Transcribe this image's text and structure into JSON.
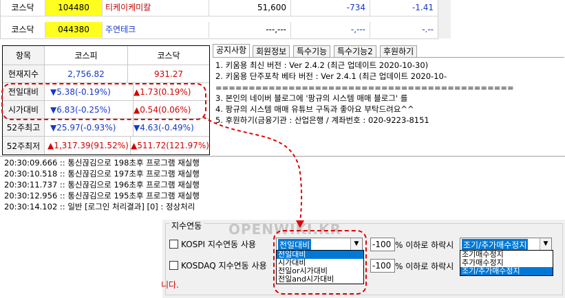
{
  "stock_table": {
    "rows": [
      {
        "market": "코스닥",
        "code": "104480",
        "name": "티케이케미칼",
        "price": "51,600",
        "change": "-734",
        "pct": "-1.41"
      },
      {
        "market": "코스닥",
        "code": "044380",
        "name": "주연테크",
        "price": "---,---",
        "change": "-,---",
        "pct": "-.--"
      }
    ]
  },
  "index_table": {
    "headers": [
      "항목",
      "코스피",
      "코스닥"
    ],
    "rows": [
      {
        "label": "현재지수",
        "kospi": "2,756.82",
        "kosdaq": "931.27"
      },
      {
        "label": "전일대비",
        "kospi": "▼5.38(-0.19%)",
        "kosdaq": "▲1.73(0.19%)"
      },
      {
        "label": "시가대비",
        "kospi": "▼6.83(-0.25%)",
        "kosdaq": "▲0.54(0.06%)"
      },
      {
        "label": "52주최고",
        "kospi": "▼25.97(-0.93%)",
        "kosdaq": "▼4.63(-0.49%)"
      },
      {
        "label": "52주최저",
        "kospi": "▲1,317.39(91.52%)",
        "kosdaq": "▲511.72(121.97%)"
      }
    ]
  },
  "notice_panel": {
    "tabs": [
      "공지사항",
      "회원정보",
      "특수기능",
      "특수기능2",
      "후원하기"
    ],
    "lines": [
      "1. 키움용 최신 버전 : Ver 2.4.2 (최근 업데이트 2020-10-30)",
      "2. 키움용 단주포착 베타 버전 : Ver 2.4.1 (최근 업데이트 2020-10-",
      "=============================================",
      "3. 본인의 네이버 블로그에 '팡규의 시스템 매매 블로그' 를",
      "4. 팡규의 시스템 매매 유튜브 구독과 좋아요 부탁드려요^^",
      "5. 후원하기(금융기관 : 산업은행 / 계좌번호 : 020-9223-8151"
    ]
  },
  "log_panel": {
    "lines": [
      "20:30:09.666 :: 통신끊김으로 198초후 프로그램 재실행",
      "20:30:10.518 :: 통신끊김으로 197초후 프로그램 재실행",
      "20:30:11.737 :: 통신끊김으로 196초후 프로그램 재실행",
      "20:30:12.956 :: 통신끊김으로 195초후 프로그램 재실행",
      "20:30:14.102 :: 일반 [로그인 처리결과] [0] : 정상처리"
    ]
  },
  "settings": {
    "group_title": "지수연동",
    "kospi_label": "KOSPI 지수연동 사용",
    "kosdaq_label": "KOSDAQ 지수연동 사용",
    "kospi_select_value": "전일대비",
    "kosdaq_select_value": "전일대비",
    "percent_value_1": "-100",
    "percent_value_2": "-100",
    "percent_suffix": "% 이하로 하락시",
    "action_select_value": "조기/추가매수정지",
    "basis_options": [
      "전일대비",
      "시가대비",
      "전일or시가대비",
      "전일and시가대비"
    ],
    "action_options": [
      "조기매수정지",
      "추가매수정지",
      "조기/추가매수정지"
    ],
    "trailing_text": "니다.",
    "watermark": "OPENWIKI.KR"
  }
}
